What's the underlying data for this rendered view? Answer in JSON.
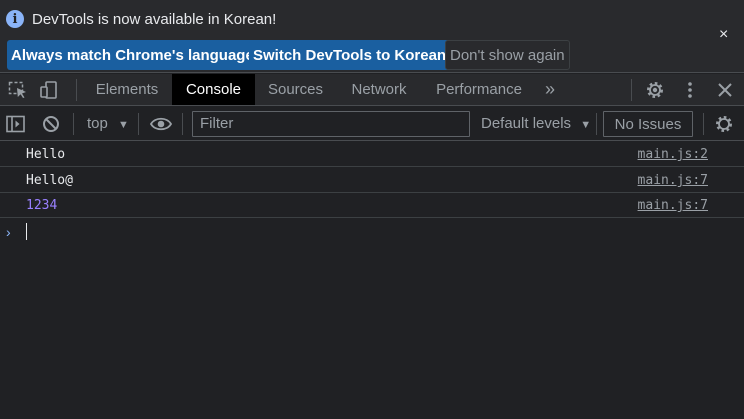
{
  "infobar": {
    "message": "DevTools is now available in Korean!",
    "info_icon_glyph": "i",
    "buttons": {
      "match": "Always match Chrome's language",
      "switch": "Switch DevTools to Korean",
      "dismiss": "Don't show again"
    },
    "close_glyph": "×"
  },
  "tabs": {
    "items": [
      "Elements",
      "Console",
      "Sources",
      "Network",
      "Performance"
    ],
    "active": "Console",
    "more_glyph": "»",
    "close_glyph": "✕"
  },
  "console_toolbar": {
    "context": "top",
    "filter_placeholder": "Filter",
    "levels": "Default levels",
    "issues": "No Issues"
  },
  "messages": [
    {
      "text": "Hello",
      "source": "main.js:2",
      "type": "log"
    },
    {
      "text": "Hello@",
      "source": "main.js:7",
      "type": "log"
    },
    {
      "text": "1234",
      "source": "main.js:7",
      "type": "number"
    }
  ],
  "prompt": {
    "glyph": "›"
  },
  "icons": {
    "info": "info-icon",
    "close": "close-icon",
    "inspect": "inspect-element-icon",
    "device": "device-toolbar-icon",
    "settings": "gear-icon",
    "menu": "kebab-menu-icon",
    "sidebar": "sidebar-toggle-icon",
    "clear": "clear-console-icon",
    "eye": "live-expression-icon"
  },
  "colors": {
    "background": "#202124",
    "toolbar": "#292a2d",
    "primary_button": "#1a5fa0",
    "accent": "#8ab4f8",
    "number": "#9980ff"
  }
}
